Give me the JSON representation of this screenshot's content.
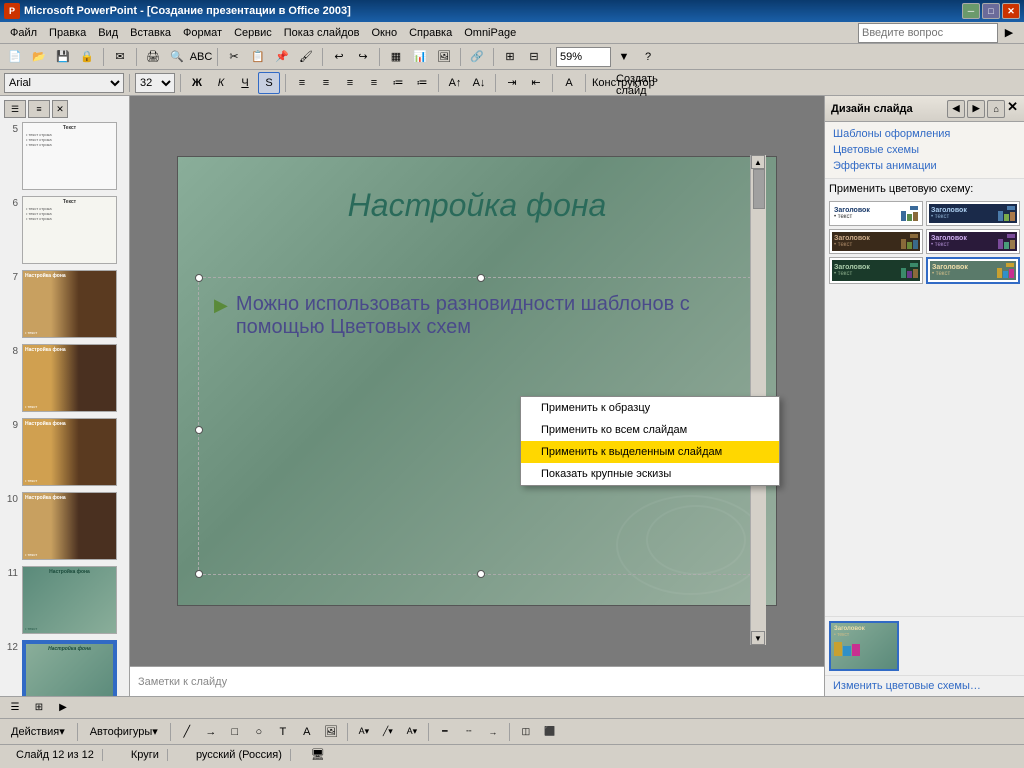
{
  "window": {
    "title": "Microsoft PowerPoint - [Создание презентации в Office 2003]",
    "icon": "PP"
  },
  "menu": {
    "items": [
      "Файл",
      "Правка",
      "Вид",
      "Вставка",
      "Формат",
      "Сервис",
      "Показ слайдов",
      "Окно",
      "Справка",
      "OmniPage"
    ]
  },
  "toolbar": {
    "zoom": "59%",
    "font": "Arial",
    "size": "32",
    "help_placeholder": "Введите вопрос"
  },
  "format_toolbar": {
    "bold": "Ж",
    "italic": "К",
    "underline": "Ч",
    "shadow": "S",
    "align_left": "≡",
    "align_center": "≡",
    "align_right": "≡",
    "bullets": "≡",
    "design_btn": "Конструктор",
    "new_slide_btn": "Создать слайд"
  },
  "slide_panel": {
    "slides": [
      {
        "num": "5",
        "type": "plain"
      },
      {
        "num": "6",
        "type": "text"
      },
      {
        "num": "7",
        "type": "image"
      },
      {
        "num": "8",
        "type": "image"
      },
      {
        "num": "9",
        "type": "image"
      },
      {
        "num": "10",
        "type": "image"
      },
      {
        "num": "11",
        "type": "teal"
      },
      {
        "num": "12",
        "type": "teal_active"
      }
    ]
  },
  "slide": {
    "title": "Настройка фона",
    "bullet": "Можно использовать разновидности шаблонов с помощью Цветовых схем"
  },
  "design_panel": {
    "title": "Дизайн слайда",
    "links": {
      "templates": "Шаблоны оформления",
      "color_schemes": "Цветовые схемы",
      "animation": "Эффекты анимации"
    },
    "apply_to_label": "Применить цветовую схему:",
    "change_link": "Изменить цветовые схемы…"
  },
  "context_menu": {
    "items": [
      {
        "label": "Применить к образцу",
        "highlighted": false
      },
      {
        "label": "Применить ко всем слайдам",
        "highlighted": false
      },
      {
        "label": "Применить к выделенным слайдам",
        "highlighted": true
      },
      {
        "label": "Показать крупные эскизы",
        "highlighted": false
      }
    ]
  },
  "notes": {
    "placeholder": "Заметки к слайду"
  },
  "status": {
    "slide_info": "Слайд 12 из 12",
    "theme": "Круги",
    "language": "русский (Россия)"
  },
  "drawing_toolbar": {
    "actions": "Действия▾",
    "autoshapes": "Автофигуры▾"
  },
  "color_schemes": [
    {
      "label": "Заголовок",
      "text": "текст",
      "bg": "white",
      "bar1": "#3a6a9a",
      "bar2": "#5a8a4a",
      "bar3": "#8a6a3a"
    },
    {
      "label": "Заголовок",
      "text": "текст",
      "bg": "#1a2a4a",
      "bar1": "#4a7aaa",
      "bar2": "#7aaa4a",
      "bar3": "#aa7a4a"
    },
    {
      "label": "Заголовок",
      "text": "текст",
      "bg": "#3a2a1a",
      "bar1": "#8a6a3a",
      "bar2": "#6a8a3a",
      "bar3": "#3a6a8a"
    },
    {
      "label": "Заголовок",
      "text": "текст",
      "bg": "#2a1a3a",
      "bar1": "#7a4a9a",
      "bar2": "#4a9a7a",
      "bar3": "#9a7a4a"
    },
    {
      "label": "Заголовок",
      "text": "текст",
      "bg": "#1a3a2a",
      "bar1": "#3a8a6a",
      "bar2": "#6a3a8a",
      "bar3": "#8a6a3a"
    },
    {
      "label": "Заголовок",
      "text": "текст",
      "bg": "#5a7a6a",
      "bar1": "#c8a030",
      "bar2": "#3090c8",
      "bar3": "#c83090"
    }
  ]
}
